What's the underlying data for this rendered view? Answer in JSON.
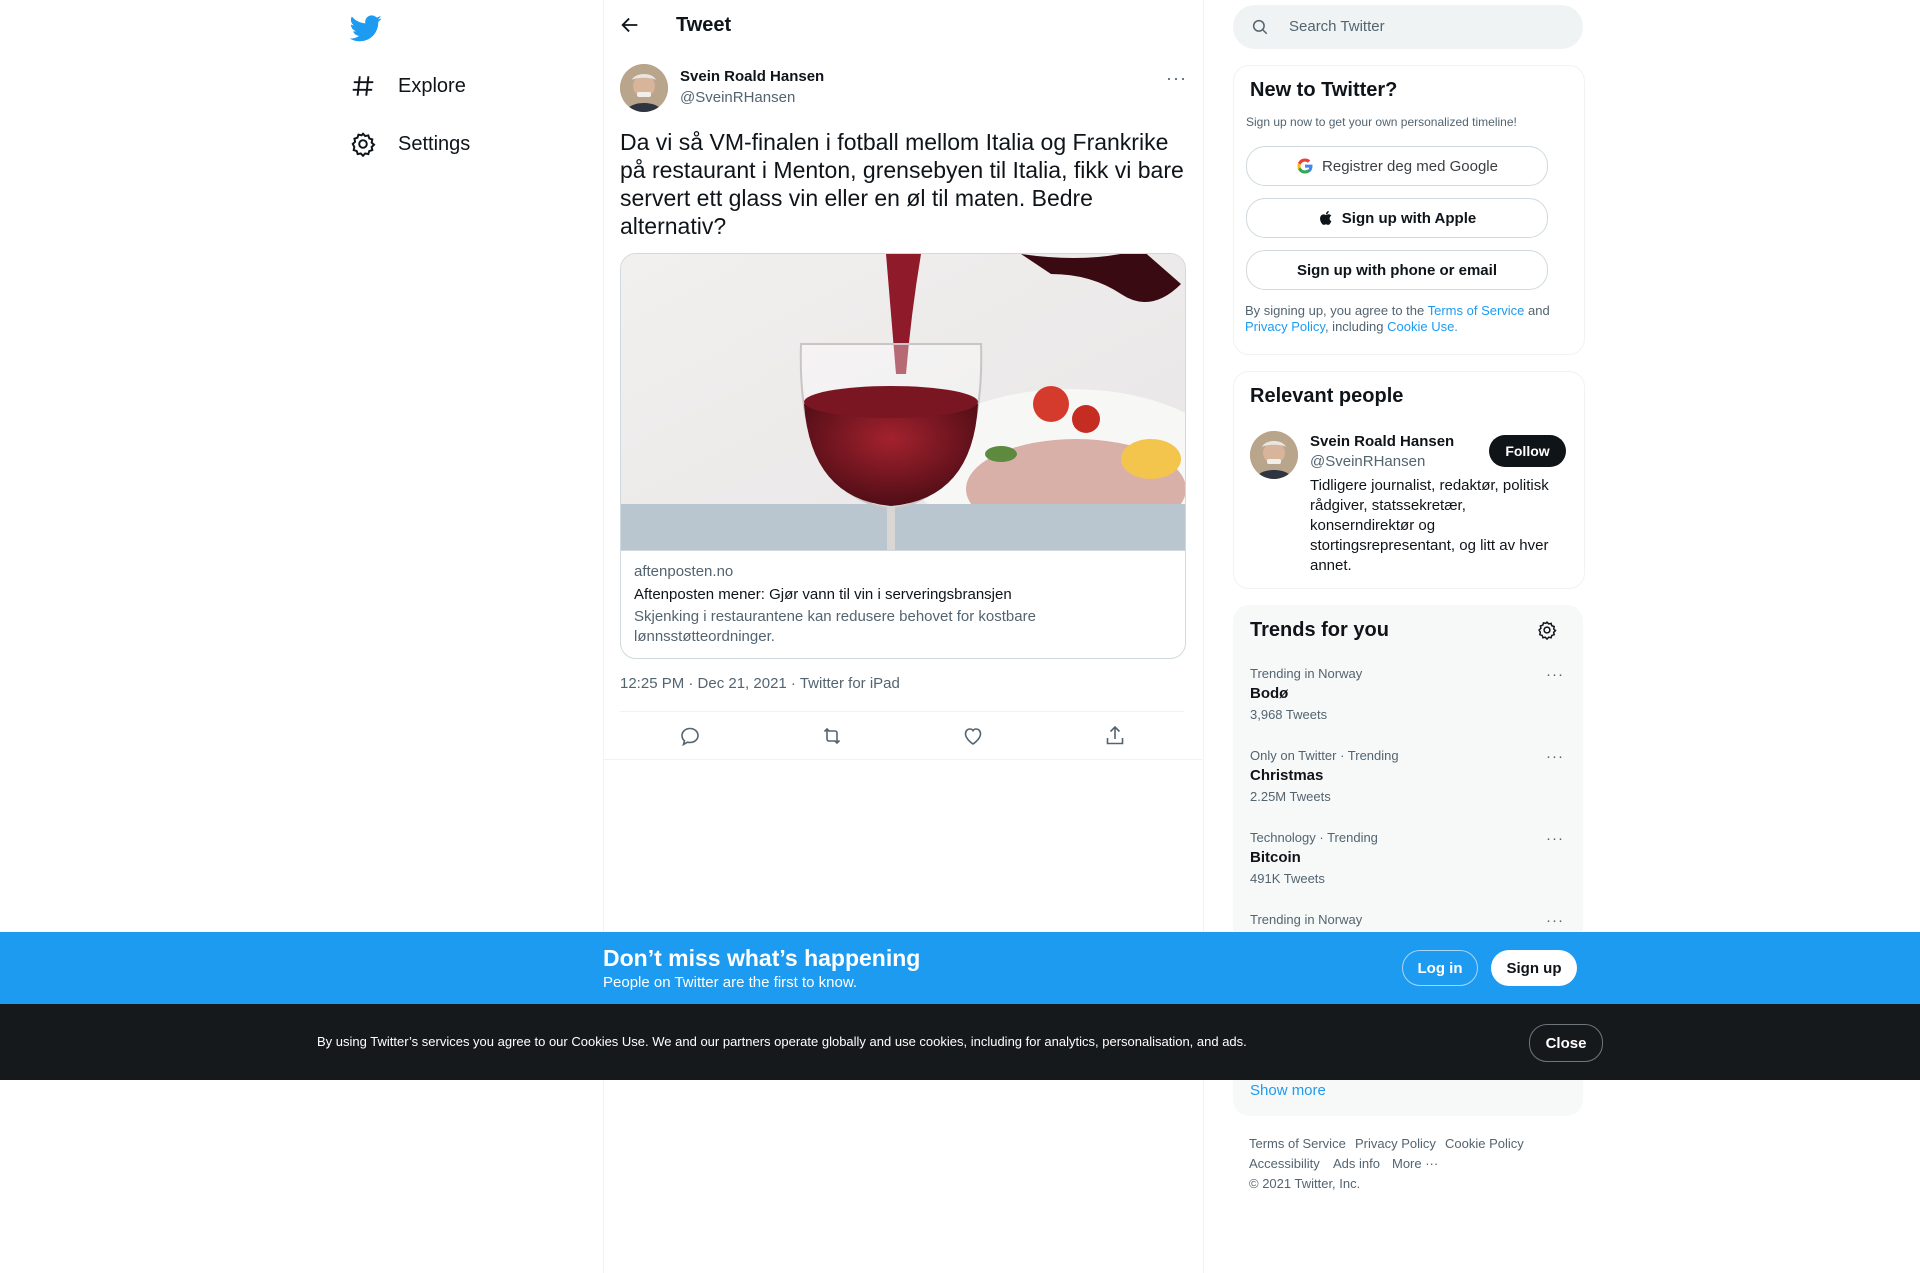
{
  "nav": {
    "logo": "twitter-bird-icon",
    "items": [
      {
        "label": "Explore",
        "icon": "hashtag-icon"
      },
      {
        "label": "Settings",
        "icon": "gear-icon"
      }
    ]
  },
  "header": {
    "title": "Tweet"
  },
  "tweet": {
    "author_name": "Svein Roald Hansen",
    "author_handle": "@SveinRHansen",
    "text": "Da vi så VM-finalen i fotball mellom Italia og Frankrike på restaurant i Menton, grensebyen til Italia, fikk vi bare servert ett glass vin eller en øl til maten. Bedre alternativ?",
    "card": {
      "domain": "aftenposten.no",
      "title": "Aftenposten mener: Gjør vann til vin i serveringsbransjen",
      "description": "Skjenking i restaurantene kan redusere behovet for kostbare lønnsstøtteordninger."
    },
    "meta": "12:25 PM · Dec 21, 2021 · Twitter for iPad",
    "actions": [
      "reply-icon",
      "retweet-icon",
      "like-icon",
      "share-icon"
    ]
  },
  "search": {
    "placeholder": "Search Twitter"
  },
  "signup_panel": {
    "title": "New to Twitter?",
    "subtitle": "Sign up now to get your own personalized timeline!",
    "google_label": "Registrer deg med Google",
    "apple_label": "Sign up with Apple",
    "phone_label": "Sign up with phone or email",
    "legal_pre": "By signing up, you agree to the ",
    "terms": "Terms of Service",
    "and": " and",
    "privacy": "Privacy Policy",
    "including": ", including ",
    "cookie_use": "Cookie Use."
  },
  "relevant": {
    "title": "Relevant people",
    "name": "Svein Roald Hansen",
    "handle": "@SveinRHansen",
    "follow_label": "Follow",
    "bio": "Tidligere journalist, redaktør, politisk rådgiver, statssekretær, konserndirektør og stortingsrepresentant, og litt av hver annet."
  },
  "trends": {
    "title": "Trends for you",
    "items": [
      {
        "meta": "Trending in Norway",
        "name": "Bodø",
        "count": "3,968 Tweets"
      },
      {
        "meta": "Only on Twitter · Trending",
        "name": "Christmas",
        "count": "2.25M Tweets"
      },
      {
        "meta": "Technology · Trending",
        "name": "Bitcoin",
        "count": "491K Tweets"
      },
      {
        "meta": "Trending in Norway",
        "name": "",
        "count": ""
      }
    ],
    "show_more": "Show more"
  },
  "footer": {
    "links": [
      "Terms of Service",
      "Privacy Policy",
      "Cookie Policy",
      "Accessibility",
      "Ads info",
      "More ···"
    ],
    "copyright": "© 2021 Twitter, Inc."
  },
  "cta": {
    "title": "Don’t miss what’s happening",
    "subtitle": "People on Twitter are the first to know.",
    "login": "Log in",
    "signup": "Sign up"
  },
  "cookie": {
    "text": "By using Twitter’s services you agree to our Cookies Use. We and our partners operate globally and use cookies, including for analytics, personalisation, and ads.",
    "close": "Close"
  },
  "colors": {
    "accent": "#1d9bf0",
    "text": "#0f1419",
    "secondary": "#536471",
    "cookie_bg": "#16191c"
  }
}
